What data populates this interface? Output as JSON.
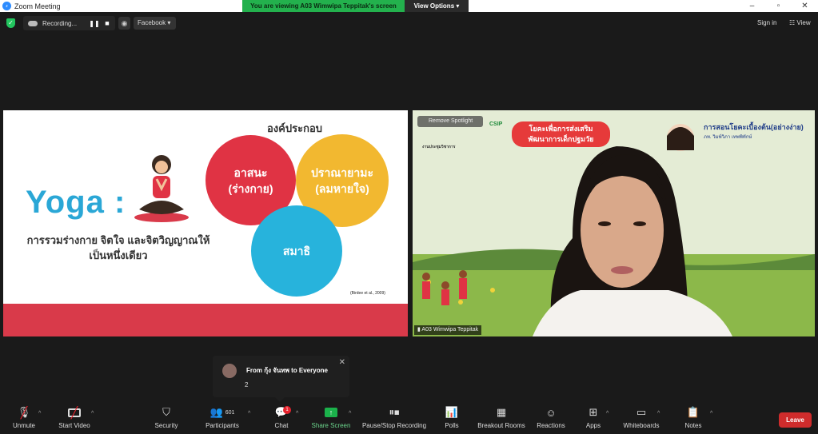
{
  "window": {
    "title": "Zoom Meeting"
  },
  "viewing_banner": {
    "message": "You are viewing A03 Wimwipa Teppitak's screen",
    "options_label": "View Options"
  },
  "topbar": {
    "recording_label": "Recording...",
    "facebook_label": "Facebook",
    "signin_label": "Sign in",
    "view_label": "View"
  },
  "slide": {
    "heading": "องค์ประกอบ",
    "yoga_title": "Yoga :",
    "description_line1": "การรวมร่างกาย จิตใจ และจิตวิญญาณให้",
    "description_line2": "เป็นหนึ่งเดียว",
    "circle1_line1": "อาสนะ",
    "circle1_line2": "(ร่างกาย)",
    "circle2_line1": "ปราณายามะ",
    "circle2_line2": "(ลมหายใจ)",
    "circle3": "สมาธิ",
    "citation": "(Birdee et al., 2009)"
  },
  "video": {
    "remove_spotlight": "Remove Spotlight",
    "participant_name": "A03 Wimwipa Teppitak",
    "banner_line1": "โยคะเพื่อการส่งเสริม",
    "banner_line2": "พัฒนาการเด็กปฐมวัย",
    "csip_label": "CSIP",
    "org_line1": "งานประชุมวิชาการ",
    "course_title": "การสอนโยคะเบื้องต้น(อย่างง่าย)",
    "teacher_name": "ภท. วิมพ์วิภา เทพพิทักษ์"
  },
  "chat_popup": {
    "from": "From กุ้ง จันทพ to Everyone",
    "message": "2"
  },
  "toolbar": {
    "unmute": "Unmute",
    "start_video": "Start Video",
    "security": "Security",
    "participants": "Participants",
    "participants_count": "601",
    "chat": "Chat",
    "chat_badge": "1",
    "share_screen": "Share Screen",
    "pause_recording": "Pause/Stop Recording",
    "polls": "Polls",
    "breakout_rooms": "Breakout Rooms",
    "reactions": "Reactions",
    "apps": "Apps",
    "whiteboards": "Whiteboards",
    "notes": "Notes",
    "leave": "Leave"
  },
  "colors": {
    "slide_red": "#d93a4a",
    "yoga_blue": "#2aa7d6",
    "share_green": "#1bb24b",
    "leave_red": "#cf2c2c",
    "banner_green": "#23b14d"
  }
}
